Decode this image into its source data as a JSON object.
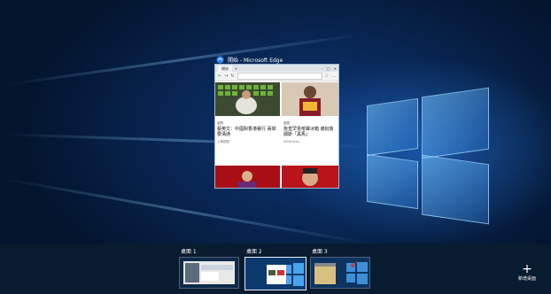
{
  "window": {
    "title": "開始 - Microsoft Edge",
    "tab_label": "開始",
    "cards": [
      {
        "tag": "遊戲",
        "headline": "蔡英文：中國對香港暴行 兩岸要溝通",
        "source": "上報觀點"
      },
      {
        "tag": "遊戲",
        "headline": "詹皇罕見嗆聲冰箱 痛批詹姆斯「黑馬」",
        "source": "NOWnews"
      }
    ]
  },
  "desktops": [
    {
      "label": "桌面 1"
    },
    {
      "label": "桌面 2"
    },
    {
      "label": "桌面 3"
    }
  ],
  "new_desktop": {
    "label": "新增桌面"
  },
  "colors": {
    "accent": "#1e88ff",
    "bar_bg": "#081c30"
  }
}
